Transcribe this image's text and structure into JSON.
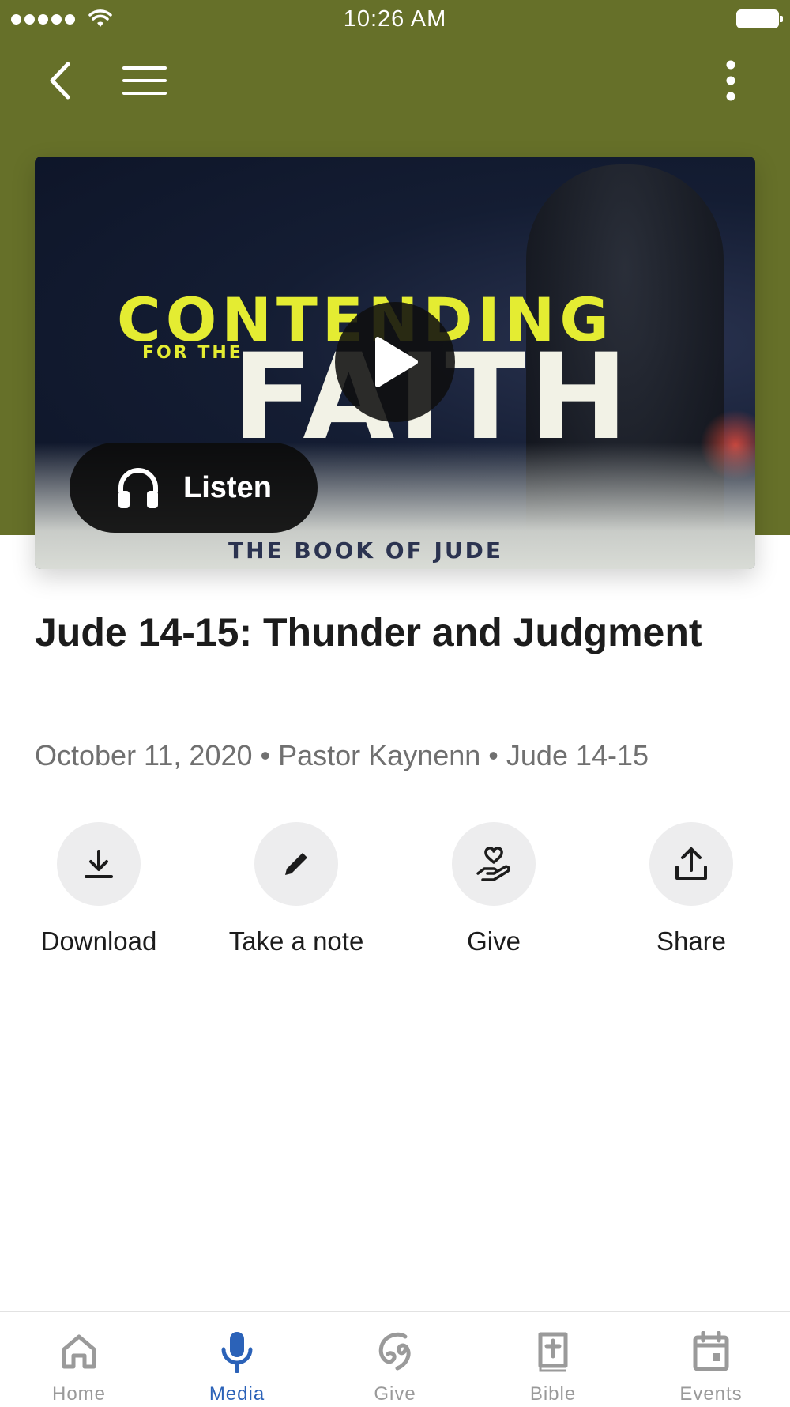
{
  "status_bar": {
    "time": "10:26 AM"
  },
  "header": {
    "bg_color": "#667029",
    "back_icon": "chevron-left-icon",
    "menu_icon": "hamburger-icon",
    "more_icon": "kebab-vertical-icon"
  },
  "hero": {
    "art_line1": "CONTENDING",
    "art_line2": "FOR THE",
    "art_line3": "FAITH",
    "art_line4": "THE BOOK OF JUDE",
    "listen_label": "Listen",
    "listen_icon": "headphones-icon",
    "play_icon": "play-icon"
  },
  "sermon": {
    "title": "Jude 14-15: Thunder and Judgment",
    "meta": "October 11, 2020 • Pastor Kaynenn • Jude 14-15"
  },
  "actions": [
    {
      "label": "Download",
      "icon": "download-icon"
    },
    {
      "label": "Take a note",
      "icon": "pencil-icon"
    },
    {
      "label": "Give",
      "icon": "hand-heart-icon"
    },
    {
      "label": "Share",
      "icon": "share-upload-icon"
    }
  ],
  "tabbar": {
    "active_color": "#2b62b8",
    "inactive_color": "#9a9a9a",
    "tabs": [
      {
        "label": "Home",
        "icon": "home-icon",
        "active": false
      },
      {
        "label": "Media",
        "icon": "microphone-icon",
        "active": true
      },
      {
        "label": "Give",
        "icon": "give-swirl-icon",
        "active": false
      },
      {
        "label": "Bible",
        "icon": "bible-icon",
        "active": false
      },
      {
        "label": "Events",
        "icon": "calendar-icon",
        "active": false
      }
    ]
  }
}
